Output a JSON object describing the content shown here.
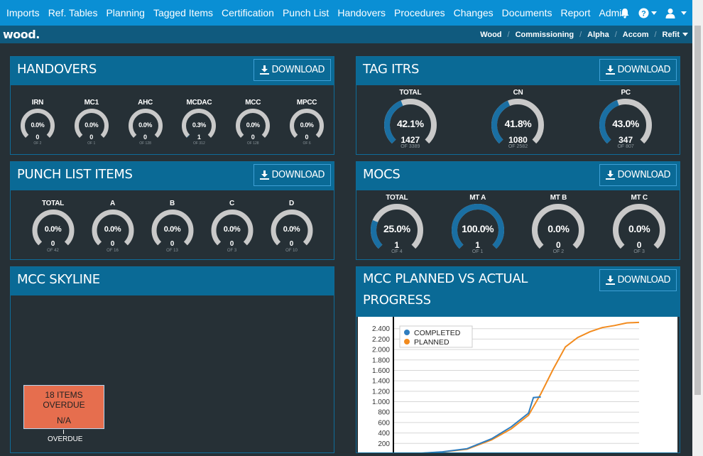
{
  "nav": {
    "items": [
      "Imports",
      "Ref. Tables",
      "Planning",
      "Tagged Items",
      "Certification",
      "Punch List",
      "Handovers",
      "Procedures",
      "Changes",
      "Documents",
      "Report",
      "Admin"
    ],
    "icons": [
      "bell-icon",
      "help-icon",
      "user-icon"
    ]
  },
  "subbar": {
    "logo": "wood.",
    "breadcrumbs": [
      "Wood",
      "Commissioning",
      "Alpha",
      "Accom",
      "Refit"
    ]
  },
  "download_label": "DOWNLOAD",
  "panels": {
    "handovers": {
      "title": "HANDOVERS",
      "gauges": [
        {
          "label": "IRN",
          "pct": "0.0%",
          "count": "0",
          "of": "OF 2",
          "fraction": 0.0
        },
        {
          "label": "MC1",
          "pct": "0.0%",
          "count": "0",
          "of": "OF 1",
          "fraction": 0.0
        },
        {
          "label": "AHC",
          "pct": "0.0%",
          "count": "0",
          "of": "OF 128",
          "fraction": 0.0
        },
        {
          "label": "MCDAC",
          "pct": "0.3%",
          "count": "1",
          "of": "OF 312",
          "fraction": 0.003
        },
        {
          "label": "MCC",
          "pct": "0.0%",
          "count": "0",
          "of": "OF 128",
          "fraction": 0.0
        },
        {
          "label": "MPCC",
          "pct": "0.0%",
          "count": "0",
          "of": "OF 6",
          "fraction": 0.0
        }
      ]
    },
    "tag_itrs": {
      "title": "TAG ITRS",
      "gauges": [
        {
          "label": "TOTAL",
          "pct": "42.1%",
          "count": "1427",
          "of": "OF 3389",
          "fraction": 0.421
        },
        {
          "label": "CN",
          "pct": "41.8%",
          "count": "1080",
          "of": "OF 2582",
          "fraction": 0.418
        },
        {
          "label": "PC",
          "pct": "43.0%",
          "count": "347",
          "of": "OF 807",
          "fraction": 0.43
        }
      ]
    },
    "punch": {
      "title": "PUNCH LIST ITEMS",
      "gauges": [
        {
          "label": "TOTAL",
          "pct": "0.0%",
          "count": "0",
          "of": "OF 42",
          "fraction": 0.0
        },
        {
          "label": "A",
          "pct": "0.0%",
          "count": "0",
          "of": "OF 16",
          "fraction": 0.0
        },
        {
          "label": "B",
          "pct": "0.0%",
          "count": "0",
          "of": "OF 13",
          "fraction": 0.0
        },
        {
          "label": "C",
          "pct": "0.0%",
          "count": "0",
          "of": "OF 3",
          "fraction": 0.0
        },
        {
          "label": "D",
          "pct": "0.0%",
          "count": "0",
          "of": "OF 10",
          "fraction": 0.0
        }
      ]
    },
    "mocs": {
      "title": "MOCS",
      "gauges": [
        {
          "label": "TOTAL",
          "pct": "25.0%",
          "count": "1",
          "of": "OF 4",
          "fraction": 0.25
        },
        {
          "label": "MT A",
          "pct": "100.0%",
          "count": "1",
          "of": "OF 1",
          "fraction": 1.0
        },
        {
          "label": "MT B",
          "pct": "0.0%",
          "count": "0",
          "of": "OF 2",
          "fraction": 0.0
        },
        {
          "label": "MT C",
          "pct": "0.0%",
          "count": "0",
          "of": "OF 3",
          "fraction": 0.0
        }
      ]
    },
    "skyline": {
      "title": "MCC SKYLINE",
      "tile_title": "18 ITEMS OVERDUE",
      "tile_value": "N/A",
      "x_label": "OVERDUE"
    },
    "progress": {
      "title_line1": "MCC PLANNED VS ACTUAL",
      "title_line2": "PROGRESS"
    }
  },
  "colors": {
    "nav": "#0a8fd4",
    "subbar": "#105a7e",
    "panel_head": "#0a6a96",
    "gauge_fill": "#1a6fa3",
    "gauge_track": "#c9c9c9",
    "completed": "#2f7ec0",
    "planned": "#f28b1e",
    "tile": "#e66e4e"
  },
  "chart_data": {
    "type": "line",
    "yticks": [
      200,
      400,
      600,
      800,
      1000,
      1200,
      1400,
      1600,
      1800,
      2000,
      2200,
      2400
    ],
    "ytick_labels": [
      "200",
      "400",
      "600",
      "800",
      "1.000",
      "1.200",
      "1.400",
      "1.600",
      "1.800",
      "2.000",
      "2.200",
      "2.400"
    ],
    "ylim": [
      0,
      2600
    ],
    "xlim": [
      0,
      100
    ],
    "legend_position": "top-left",
    "series": [
      {
        "name": "COMPLETED",
        "x": [
          0,
          10,
          20,
          30,
          40,
          48,
          55,
          57,
          60
        ],
        "y": [
          0,
          10,
          40,
          100,
          290,
          520,
          780,
          1080,
          1090
        ]
      },
      {
        "name": "PLANNED",
        "x": [
          0,
          10,
          20,
          30,
          40,
          48,
          55,
          60,
          65,
          70,
          75,
          80,
          85,
          90,
          95,
          100
        ],
        "y": [
          0,
          8,
          35,
          90,
          270,
          480,
          740,
          1150,
          1620,
          2050,
          2230,
          2340,
          2420,
          2460,
          2510,
          2520
        ]
      }
    ]
  }
}
